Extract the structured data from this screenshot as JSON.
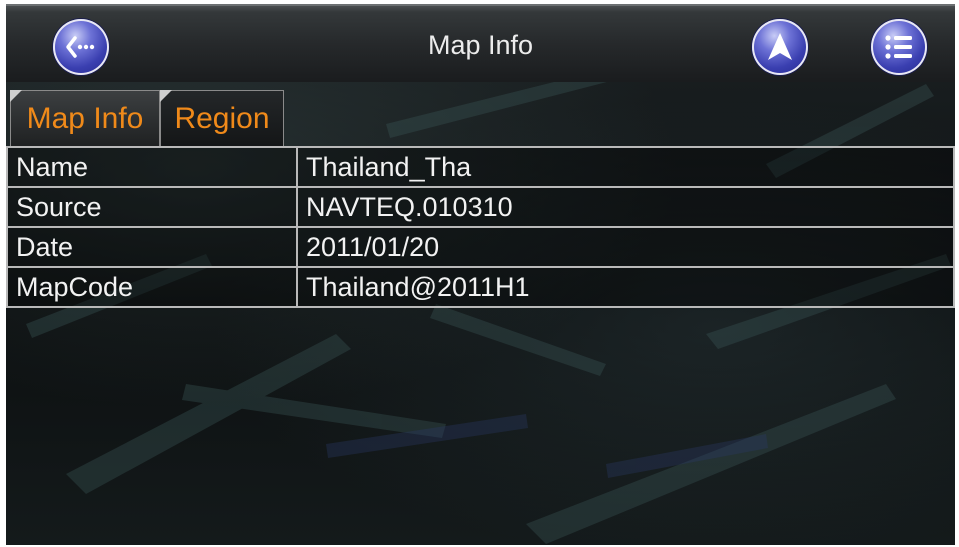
{
  "header": {
    "title": "Map Info",
    "back_icon": "back-ellipsis-icon",
    "navigate_icon": "navigation-arrow-icon",
    "menu_icon": "list-menu-icon",
    "button_color": "#3a3fb0"
  },
  "tabs": [
    {
      "label": "Map Info",
      "active": true
    },
    {
      "label": "Region",
      "active": false
    }
  ],
  "tab_text_color": "#f08a1a",
  "map_info": {
    "rows": [
      {
        "label": "Name",
        "value": "Thailand_Tha"
      },
      {
        "label": "Source",
        "value": "NAVTEQ.010310"
      },
      {
        "label": "Date",
        "value": "2011/01/20"
      },
      {
        "label": "MapCode",
        "value": "Thailand@2011H1"
      }
    ]
  }
}
